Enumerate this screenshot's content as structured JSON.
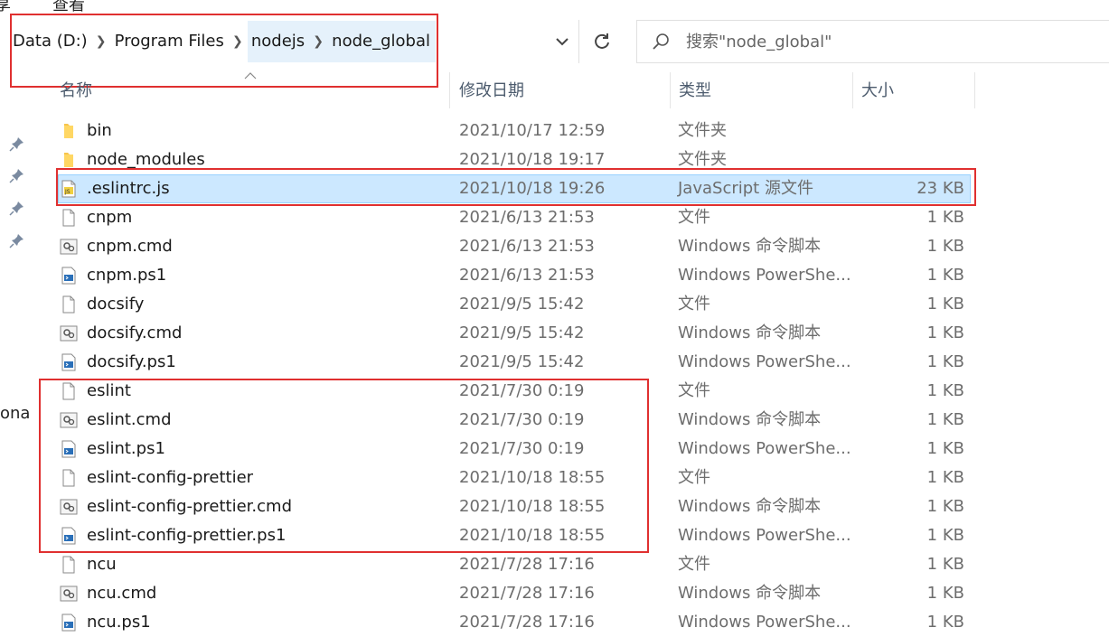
{
  "ribbon": {
    "tab_share": "享",
    "tab_view": "查看"
  },
  "address": {
    "segments": [
      "Data (D:)",
      "Program Files",
      "nodejs",
      "node_global"
    ]
  },
  "search": {
    "placeholder": "搜索\"node_global\""
  },
  "columns": {
    "name": "名称",
    "date": "修改日期",
    "type": "类型",
    "size": "大小"
  },
  "sidebar": {
    "partial_text": "ona"
  },
  "icons": {
    "folder": "folder-icon",
    "js": "js-file-icon",
    "file": "blank-file-icon",
    "cmd": "cmd-script-icon",
    "ps1": "powershell-script-icon"
  },
  "colors": {
    "highlight_box": "#e03030",
    "selection": "#cce8ff",
    "folder": "#f7c44a"
  },
  "files": [
    {
      "name": "bin",
      "date": "2021/10/17 12:59",
      "type": "文件夹",
      "size": "",
      "icon": "folder"
    },
    {
      "name": "node_modules",
      "date": "2021/10/18 19:17",
      "type": "文件夹",
      "size": "",
      "icon": "folder"
    },
    {
      "name": ".eslintrc.js",
      "date": "2021/10/18 19:26",
      "type": "JavaScript 源文件",
      "size": "23 KB",
      "icon": "js",
      "selected": true
    },
    {
      "name": "cnpm",
      "date": "2021/6/13 21:53",
      "type": "文件",
      "size": "1 KB",
      "icon": "file"
    },
    {
      "name": "cnpm.cmd",
      "date": "2021/6/13 21:53",
      "type": "Windows 命令脚本",
      "size": "1 KB",
      "icon": "cmd"
    },
    {
      "name": "cnpm.ps1",
      "date": "2021/6/13 21:53",
      "type": "Windows PowerShe...",
      "size": "1 KB",
      "icon": "ps1"
    },
    {
      "name": "docsify",
      "date": "2021/9/5 15:42",
      "type": "文件",
      "size": "1 KB",
      "icon": "file"
    },
    {
      "name": "docsify.cmd",
      "date": "2021/9/5 15:42",
      "type": "Windows 命令脚本",
      "size": "1 KB",
      "icon": "cmd"
    },
    {
      "name": "docsify.ps1",
      "date": "2021/9/5 15:42",
      "type": "Windows PowerShe...",
      "size": "1 KB",
      "icon": "ps1"
    },
    {
      "name": "eslint",
      "date": "2021/7/30 0:19",
      "type": "文件",
      "size": "1 KB",
      "icon": "file"
    },
    {
      "name": "eslint.cmd",
      "date": "2021/7/30 0:19",
      "type": "Windows 命令脚本",
      "size": "1 KB",
      "icon": "cmd"
    },
    {
      "name": "eslint.ps1",
      "date": "2021/7/30 0:19",
      "type": "Windows PowerShe...",
      "size": "1 KB",
      "icon": "ps1"
    },
    {
      "name": "eslint-config-prettier",
      "date": "2021/10/18 18:55",
      "type": "文件",
      "size": "1 KB",
      "icon": "file"
    },
    {
      "name": "eslint-config-prettier.cmd",
      "date": "2021/10/18 18:55",
      "type": "Windows 命令脚本",
      "size": "1 KB",
      "icon": "cmd"
    },
    {
      "name": "eslint-config-prettier.ps1",
      "date": "2021/10/18 18:55",
      "type": "Windows PowerShe...",
      "size": "1 KB",
      "icon": "ps1"
    },
    {
      "name": "ncu",
      "date": "2021/7/28 17:16",
      "type": "文件",
      "size": "1 KB",
      "icon": "file"
    },
    {
      "name": "ncu.cmd",
      "date": "2021/7/28 17:16",
      "type": "Windows 命令脚本",
      "size": "1 KB",
      "icon": "cmd"
    },
    {
      "name": "ncu.ps1",
      "date": "2021/7/28 17:16",
      "type": "Windows PowerShe...",
      "size": "1 KB",
      "icon": "ps1"
    }
  ]
}
